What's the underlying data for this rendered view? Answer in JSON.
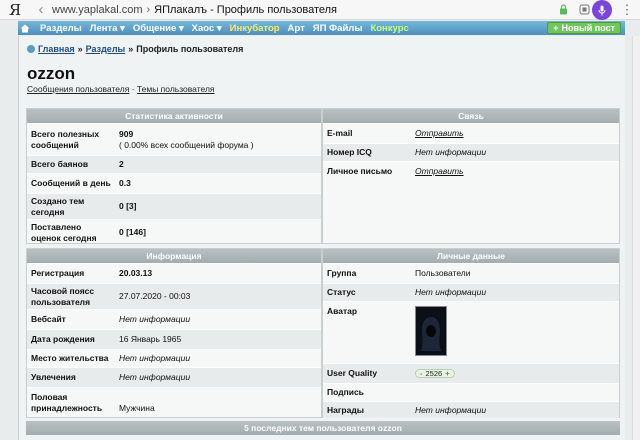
{
  "browser": {
    "logo": "Я",
    "domain": "www.yaplakal.com",
    "separator": "›",
    "tab_title": "ЯПлакалъ - Профиль пользователя"
  },
  "nav": {
    "items": [
      {
        "label": "Разделы",
        "color": "white"
      },
      {
        "label": "Лента ▾",
        "color": "white"
      },
      {
        "label": "Общение ▾",
        "color": "white"
      },
      {
        "label": "Хаос ▾",
        "color": "white"
      },
      {
        "label": "Инкубатор",
        "color": "yellow"
      },
      {
        "label": "Арт",
        "color": "white"
      },
      {
        "label": "ЯП Файлы",
        "color": "white"
      },
      {
        "label": "Конкурс",
        "color": "green"
      }
    ],
    "new_post": "Новый пост"
  },
  "breadcrumb": {
    "home": "Главная",
    "sections": "Разделы",
    "current": "Профиль пользователя",
    "sep": "»"
  },
  "profile": {
    "username": "ozzon",
    "link_posts": "Сообщения пользователя",
    "link_sep": "·",
    "link_topics": "Темы пользователя"
  },
  "stats": {
    "title": "Статистика активности",
    "posts_label": "Всего полезных сообщений",
    "posts_value": "909",
    "posts_note": "( 0.00% всех сообщений форума )",
    "bans_label": "Всего баянов",
    "bans_value": "2",
    "per_day_label": "Сообщений в день",
    "per_day_value": "0.3",
    "topics_today_label": "Создано тем сегодня",
    "topics_today_value": "0 [3]",
    "ratings_today_label": "Поставлено оценок сегодня",
    "ratings_today_value": "0 [146]"
  },
  "contact": {
    "title": "Связь",
    "email_label": "E-mail",
    "email_value": "Отправить",
    "icq_label": "Номер ICQ",
    "icq_value": "Нет информации",
    "pm_label": "Личное письмо",
    "pm_value": "Отправить"
  },
  "info": {
    "title": "Информация",
    "reg_label": "Регистрация",
    "reg_value": "20.03.13",
    "tz_label": "Часовой поясс пользователя",
    "tz_value": "27.07.2020 - 00:03",
    "site_label": "Вебсайт",
    "site_value": "Нет информации",
    "birth_label": "Дата рождения",
    "birth_value": "16 Январь 1965",
    "city_label": "Место жительства",
    "city_value": "Нет информации",
    "hobby_label": "Увлечения",
    "hobby_value": "Нет информации",
    "gender_label": "Половая принадлежность",
    "gender_value": "Мужчина"
  },
  "personal": {
    "title": "Личные данные",
    "group_label": "Группа",
    "group_value": "Пользователи",
    "status_label": "Статус",
    "status_value": "Нет информации",
    "avatar_label": "Аватар",
    "quality_label": "User Quality",
    "quality_minus": "-",
    "quality_value": "2526",
    "quality_plus": "+",
    "signature_label": "Подпись",
    "awards_label": "Награды",
    "awards_value": "Нет информации"
  },
  "bottom": {
    "title": "5 последних тем пользователя ozzon"
  },
  "colors": {
    "nav_bg": "#5b9dc8",
    "header_gray": "#aab3b5",
    "new_post_green": "#6fc65f",
    "mic_purple": "#7a46d8"
  }
}
